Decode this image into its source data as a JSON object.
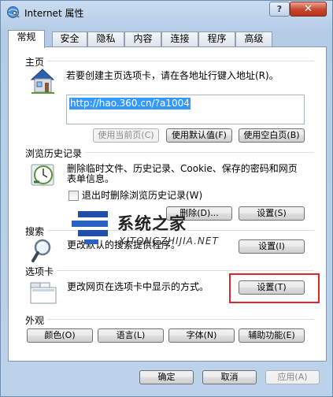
{
  "window": {
    "title": "Internet 属性"
  },
  "title_buttons": {
    "help": "?",
    "close": "✕"
  },
  "tabs": [
    "常规",
    "安全",
    "隐私",
    "内容",
    "连接",
    "程序",
    "高级"
  ],
  "home": {
    "label": "主页",
    "description": "若要创建主页选项卡，请在各地址行键入地址(R)。",
    "url": "http://hao.360.cn/?a1004",
    "btn_current": "使用当前页(C)",
    "btn_default": "使用默认值(F)",
    "btn_blank": "使用空白页(B)"
  },
  "history": {
    "label": "浏览历史记录",
    "description_line1": "删除临时文件、历史记录、Cookie、保存的密码和网页",
    "description_line2": "表单信息。",
    "checkbox_label": "退出时删除浏览历史记录(W)",
    "btn_delete": "删除(D)...",
    "btn_settings": "设置(S)"
  },
  "search": {
    "label": "搜索",
    "description": "更改默认的搜索提供程序。",
    "btn_settings": "设置(I)"
  },
  "tabs_group": {
    "label": "选项卡",
    "description": "更改网页在选项卡中显示的方式。",
    "btn_settings": "设置(T)"
  },
  "appearance": {
    "label": "外观",
    "btn_colors": "颜色(O)",
    "btn_languages": "语言(L)",
    "btn_fonts": "字体(N)",
    "btn_accessibility": "辅助功能(E)"
  },
  "footer": {
    "ok": "确定",
    "cancel": "取消",
    "apply": "应用(A)"
  },
  "watermark": {
    "brand": "系统之家",
    "url": "XITONGZHIJIA.NET"
  },
  "colors": {
    "highlight": "#e0262b",
    "selection": "#3399ff"
  }
}
